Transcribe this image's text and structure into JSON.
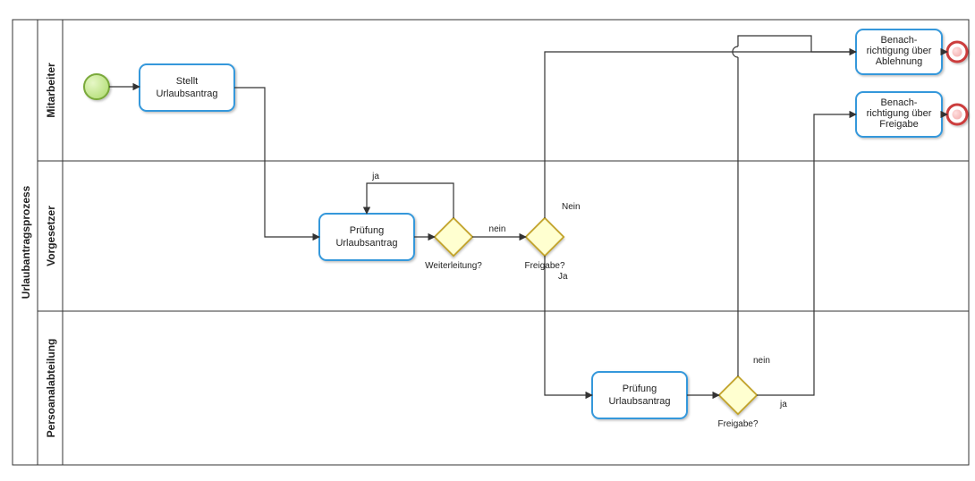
{
  "pool": {
    "title": "Urlaubantragsprozess"
  },
  "lanes": {
    "employee": "Mitarbeiter",
    "supervisor": "Vorgesetzer",
    "hr": "Persoanalabteilung"
  },
  "tasks": {
    "submit": {
      "line1": "Stellt",
      "line2": "Urlaubsantrag"
    },
    "review1": {
      "line1": "Prüfung",
      "line2": "Urlaubsantrag"
    },
    "review2": {
      "line1": "Prüfung",
      "line2": "Urlaubsantrag"
    },
    "notify_reject": {
      "line1": "Benach-",
      "line2": "richtigung über",
      "line3": "Ablehnung"
    },
    "notify_approve": {
      "line1": "Benach-",
      "line2": "richtigung über",
      "line3": "Freigabe"
    }
  },
  "gateways": {
    "forward": "Weiterleitung?",
    "approve1": "Freigabe?",
    "approve2": "Freigabe?"
  },
  "labels": {
    "g1_yes": "ja",
    "g1_no": "nein",
    "g2_no": "Nein",
    "g2_yes": "Ja",
    "g3_no": "nein",
    "g3_yes": "ja"
  }
}
